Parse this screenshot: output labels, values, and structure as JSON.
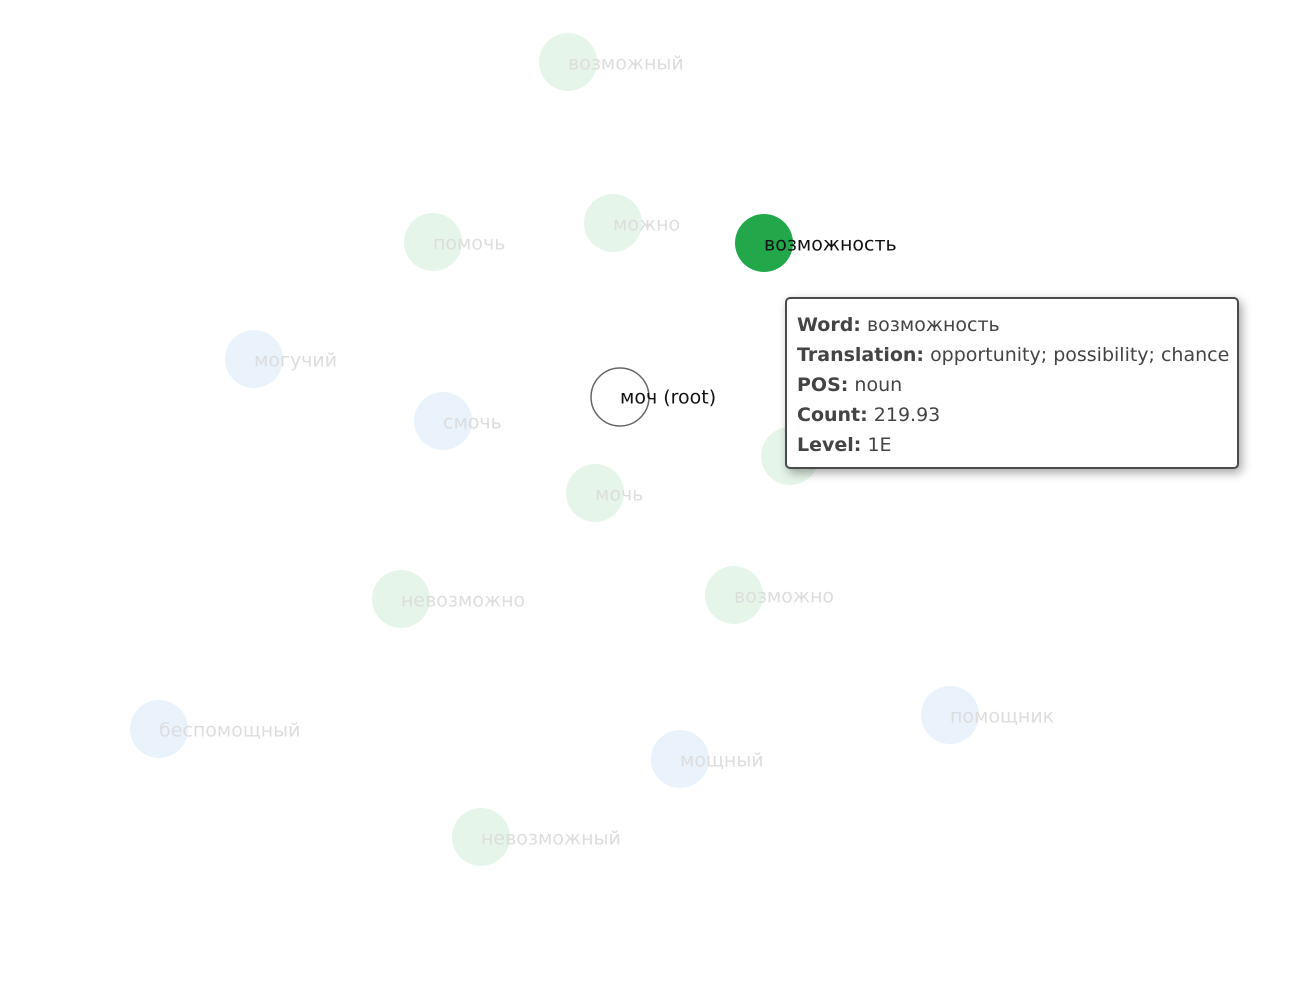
{
  "root": {
    "label": "моч (root)",
    "fill": "#ffffff",
    "stroke": "#666666"
  },
  "colors": {
    "green": "#22a84a",
    "blue": "#7fb2ec",
    "green_faded": "#e6f5ea",
    "blue_faded": "#eaf2fc",
    "text_faded": "#dddddd",
    "text_active": "#111111"
  },
  "nodes": [
    {
      "id": "vozmozhny",
      "label": "возможный",
      "color": "green",
      "state": "faded"
    },
    {
      "id": "pomoch",
      "label": "помочь",
      "color": "green",
      "state": "faded"
    },
    {
      "id": "mozhno",
      "label": "можно",
      "color": "green",
      "state": "faded"
    },
    {
      "id": "vozmozhnost",
      "label": "возможность",
      "color": "green",
      "state": "active"
    },
    {
      "id": "moguchiy",
      "label": "могучий",
      "color": "blue",
      "state": "faded"
    },
    {
      "id": "smoch",
      "label": "смочь",
      "color": "blue",
      "state": "faded"
    },
    {
      "id": "hidden",
      "label": "",
      "color": "green",
      "state": "faded"
    },
    {
      "id": "moch",
      "label": "мочь",
      "color": "green",
      "state": "faded"
    },
    {
      "id": "nevozmozhno",
      "label": "невозможно",
      "color": "green",
      "state": "faded"
    },
    {
      "id": "vozmozhno",
      "label": "возможно",
      "color": "green",
      "state": "faded"
    },
    {
      "id": "bespomoshchny",
      "label": "беспомощный",
      "color": "blue",
      "state": "faded"
    },
    {
      "id": "pomoshchnik",
      "label": "помощник",
      "color": "blue",
      "state": "faded"
    },
    {
      "id": "moshchny",
      "label": "мощный",
      "color": "blue",
      "state": "faded"
    },
    {
      "id": "nevozmozhny",
      "label": "невозможный",
      "color": "green",
      "state": "faded"
    }
  ],
  "tooltip": {
    "word_key": "Word:",
    "word": "возможность",
    "translation_key": "Translation:",
    "translation": "opportunity; possibility; chance",
    "pos_key": "POS:",
    "pos": "noun",
    "count_key": "Count:",
    "count": "219.93",
    "level_key": "Level:",
    "level": "1E"
  }
}
